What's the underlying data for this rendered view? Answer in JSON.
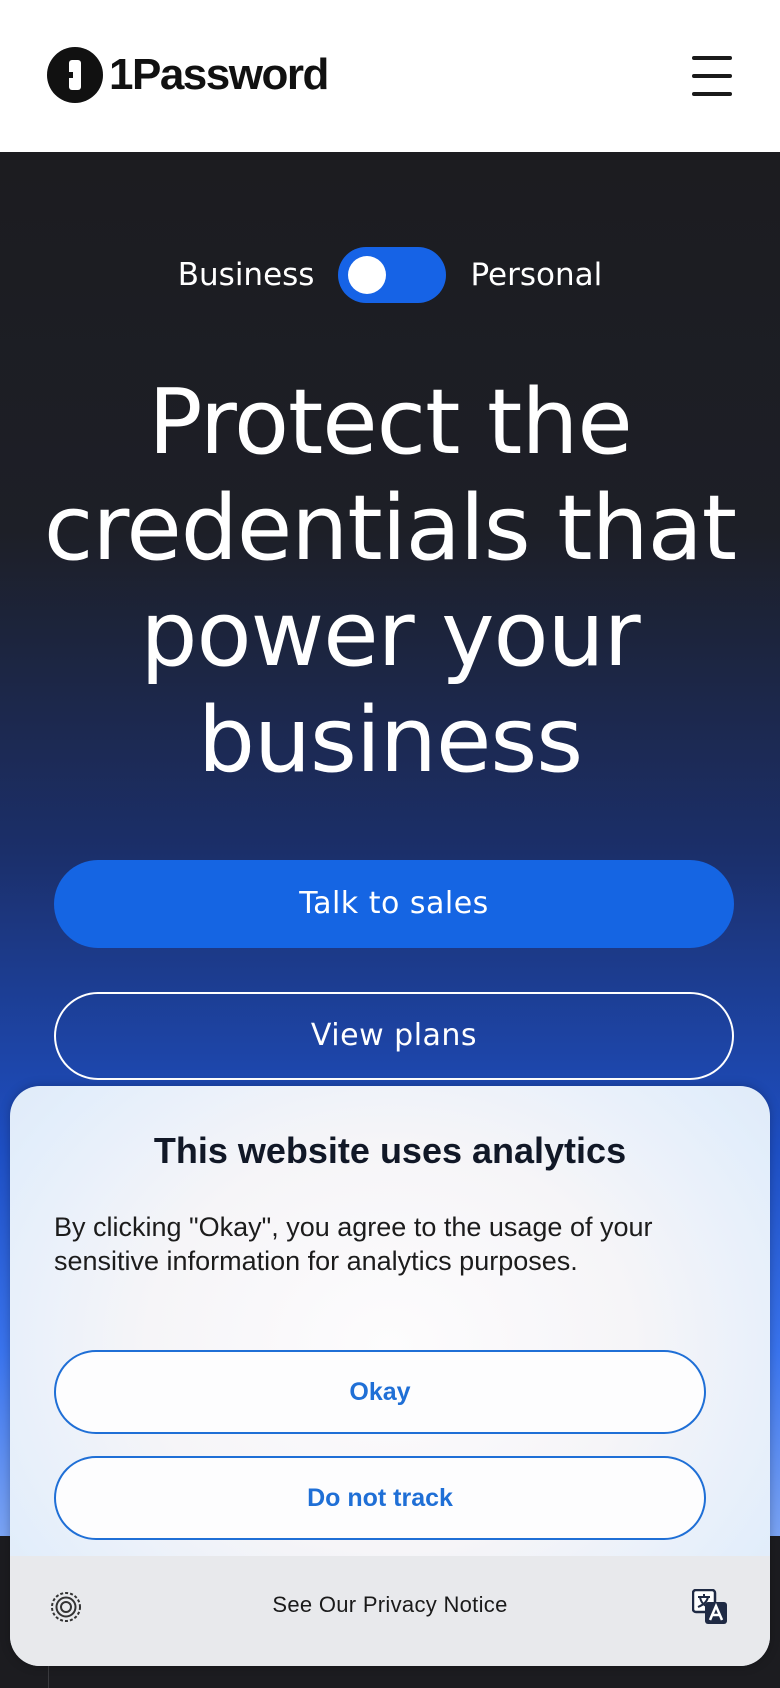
{
  "header": {
    "logo_text": "1Password",
    "logo_icon": "1password-logo-icon",
    "menu_icon": "hamburger-menu-icon"
  },
  "hero": {
    "toggle": {
      "left_label": "Business",
      "right_label": "Personal",
      "selected": "Business"
    },
    "headline": "Protect the credentials that power your business",
    "primary_button": "Talk to sales",
    "secondary_button": "View plans"
  },
  "consent": {
    "title": "This website uses analytics",
    "body": "By clicking \"Okay\", you agree to the usage of your sensitive information for analytics purposes.",
    "okay_button": "Okay",
    "do_not_track_button": "Do not track",
    "privacy_link": "See Our Privacy Notice",
    "privacy_icon": "privacy-shield-icon",
    "language_icon": "translate-icon"
  },
  "colors": {
    "accent": "#1565e3",
    "consent_accent": "#1f6fd6",
    "hero_dark": "#1c1c20"
  }
}
